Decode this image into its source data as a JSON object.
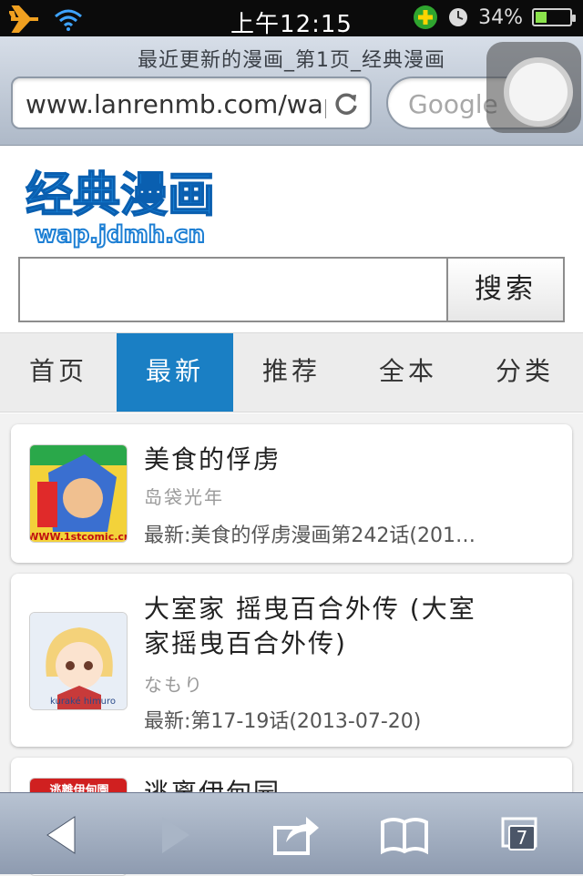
{
  "status_bar": {
    "time": "上午12:15",
    "battery_percent": "34%",
    "battery_level": 0.34
  },
  "browser": {
    "page_title": "最近更新的漫画_第1页_经典漫画",
    "url": "www.lanrenmb.com/wap",
    "search_placeholder": "Google",
    "tab_count": "7"
  },
  "site": {
    "logo_text": "经典漫画",
    "logo_domain": "wap.jdmh.cn",
    "search_button": "搜索",
    "nav": [
      {
        "label": "首页",
        "active": false
      },
      {
        "label": "最新",
        "active": true
      },
      {
        "label": "推荐",
        "active": false
      },
      {
        "label": "全本",
        "active": false
      },
      {
        "label": "分类",
        "active": false
      }
    ],
    "comics": [
      {
        "title": "美食的俘虏",
        "author": "岛袋光年",
        "latest": "最新:美食的俘虏漫画第242话(201…",
        "thumb_caption": "WWW.1stcomic.cn"
      },
      {
        "title_line1": "大室家 摇曳百合外传 (大室",
        "title_line2": "家摇曳百合外传)",
        "author": "なもり",
        "latest": "最新:第17-19话(2013-07-20)",
        "thumb_caption": "kuraké himuro"
      },
      {
        "title": "逃离伊甸园",
        "thumb_caption": "逃離伊甸園"
      }
    ]
  },
  "colors": {
    "nav_active": "#1a7fc4",
    "status_bar": "#0b0b0b",
    "toolbar": "#8e9bb0"
  },
  "icons": {
    "status": [
      "airplane-icon",
      "wifi-icon",
      "plus-badge-icon",
      "clock-icon",
      "battery-icon"
    ],
    "browser": [
      "reload-icon"
    ],
    "toolbar": [
      "back-icon",
      "forward-icon",
      "share-icon",
      "bookmarks-icon",
      "tabs-icon"
    ]
  }
}
